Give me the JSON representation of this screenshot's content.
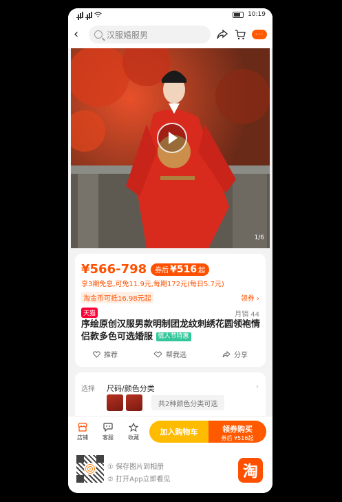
{
  "status_bar": {
    "time": "10:19"
  },
  "header": {
    "search_placeholder": "汉服婚服男",
    "more_label": "···"
  },
  "hero": {
    "pager": "1/6"
  },
  "product": {
    "price": "¥566-798",
    "coupon_prefix": "券后",
    "coupon_price": "¥516",
    "coupon_suffix": "起",
    "installment": "享3期免息,可免11.9元,每期172元(每日5.7元)",
    "taojin": "淘金币可抵16.98元起",
    "get_coupon": "领券",
    "tmall_badge": "天猫",
    "monthly_sales": "月销 44",
    "title": "序绘原创汉服男款明制团龙纹刺绣花圆领袍情侣款多色可选婚服",
    "promo_badge": "情人节特惠",
    "actions": {
      "recommend": "推荐",
      "help_choose": "帮我选",
      "share": "分享"
    }
  },
  "sku": {
    "label": "选择",
    "name": "尺码/颜色分类",
    "count_text": "共2种颜色分类可选"
  },
  "bottom_bar": {
    "shop": "店铺",
    "service": "客服",
    "favorite": "收藏",
    "add_cart": "加入购物车",
    "buy": "领券购买",
    "buy_sub": "券后 ¥516起"
  },
  "footer": {
    "tip1": "① 保存图片到相册",
    "tip2": "② 打开App立即看见",
    "taobao_logo": "淘"
  }
}
